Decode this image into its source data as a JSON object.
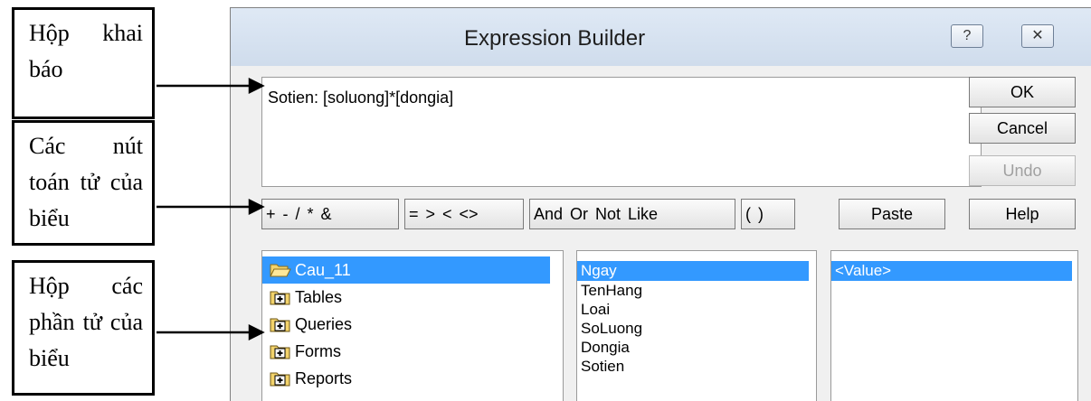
{
  "callouts": [
    {
      "text": "Hộp khai báo"
    },
    {
      "text": "Các nút toán tử của biểu"
    },
    {
      "text": "Hộp các phần tử của biểu"
    }
  ],
  "dialog": {
    "title": "Expression Builder",
    "help_glyph": "?",
    "close_glyph": "✕",
    "expression": "Sotien: [soluong]*[dongia]",
    "buttons": {
      "ok": "OK",
      "cancel": "Cancel",
      "undo": "Undo",
      "paste": "Paste",
      "help": "Help"
    },
    "operators": {
      "plus": "+",
      "minus": "-",
      "divide": "/",
      "multiply": "*",
      "ampersand": "&",
      "eq": "=",
      "gt": ">",
      "lt": "<",
      "ne": "<>",
      "and": "And",
      "or": "Or",
      "not": "Not",
      "like": "Like",
      "lparen": "(",
      "rparen": ")"
    },
    "folders": [
      {
        "label": "Cau_11",
        "icon": "open-folder-icon",
        "selected": true
      },
      {
        "label": "Tables",
        "icon": "plus-folder-icon",
        "selected": false
      },
      {
        "label": "Queries",
        "icon": "plus-folder-icon",
        "selected": false
      },
      {
        "label": "Forms",
        "icon": "plus-folder-icon",
        "selected": false
      },
      {
        "label": "Reports",
        "icon": "plus-folder-icon",
        "selected": false
      }
    ],
    "fields": [
      {
        "label": "Ngay",
        "selected": true
      },
      {
        "label": "TenHang",
        "selected": false
      },
      {
        "label": "Loai",
        "selected": false
      },
      {
        "label": "SoLuong",
        "selected": false
      },
      {
        "label": "Dongia",
        "selected": false
      },
      {
        "label": "Sotien",
        "selected": false
      }
    ],
    "values": [
      {
        "label": "<Value>",
        "selected": true
      }
    ],
    "colors": {
      "selection": "#3399ff",
      "titlebar": "#d9e4f2"
    }
  }
}
